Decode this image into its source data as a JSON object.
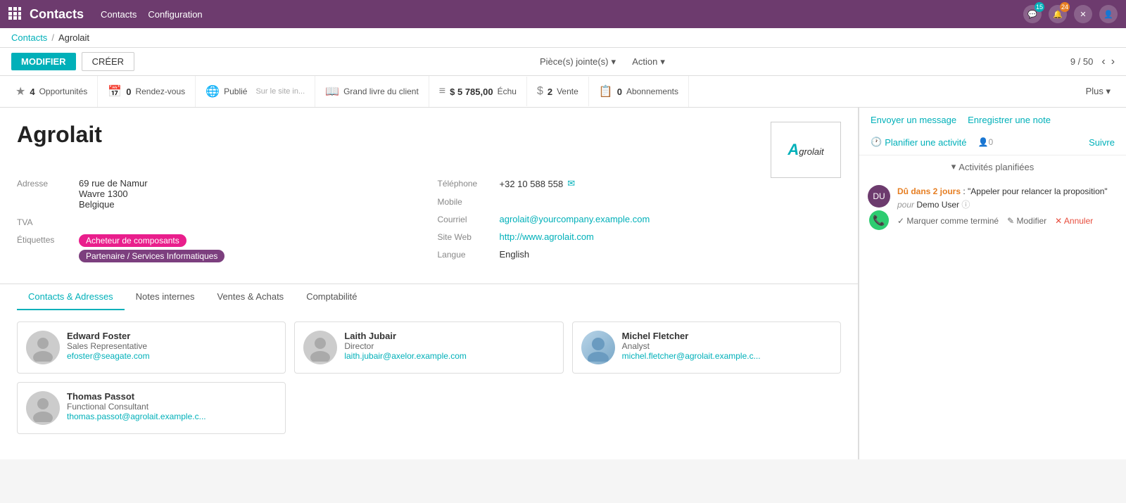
{
  "app": {
    "title": "Contacts",
    "nav_links": [
      "Contacts",
      "Configuration"
    ],
    "badge1": "15",
    "badge2": "24"
  },
  "breadcrumb": {
    "parent": "Contacts",
    "current": "Agrolait"
  },
  "toolbar": {
    "modifier_label": "MODIFIER",
    "creer_label": "CRÉER",
    "piecejointe_label": "Pièce(s) jointe(s)",
    "action_label": "Action",
    "nav_count": "9 / 50"
  },
  "stats": [
    {
      "icon": "★",
      "num": "4",
      "label": "Opportunités"
    },
    {
      "icon": "📅",
      "num": "0",
      "label": "Rendez-vous"
    },
    {
      "icon": "🌐",
      "num": "",
      "label": "Publié",
      "sub": "Sur le site in..."
    },
    {
      "icon": "📖",
      "num": "",
      "label": "Grand livre du client"
    },
    {
      "icon": "≡",
      "num": "$ 5 785,00",
      "label": "Échu"
    },
    {
      "icon": "$",
      "num": "2",
      "label": "Vente"
    },
    {
      "icon": "📋",
      "num": "0",
      "label": "Abonnements"
    },
    {
      "label": "Plus"
    }
  ],
  "contact": {
    "name": "Agrolait",
    "logo_text": "Agrolait",
    "address_label": "Adresse",
    "address_line1": "69 rue de Namur",
    "address_line2": "Wavre  1300",
    "address_line3": "Belgique",
    "tva_label": "TVA",
    "tva_value": "",
    "etiquettes_label": "Étiquettes",
    "tags": [
      {
        "label": "Acheteur de composants",
        "color": "pink"
      },
      {
        "label": "Partenaire / Services Informatiques",
        "color": "purple"
      }
    ],
    "telephone_label": "Téléphone",
    "telephone_value": "+32 10 588 558",
    "mobile_label": "Mobile",
    "mobile_value": "",
    "courriel_label": "Courriel",
    "courriel_value": "agrolait@yourcompany.example.com",
    "siteweb_label": "Site Web",
    "siteweb_value": "http://www.agrolait.com",
    "langue_label": "Langue",
    "langue_value": "English"
  },
  "tabs": [
    {
      "label": "Contacts & Adresses",
      "active": true
    },
    {
      "label": "Notes internes"
    },
    {
      "label": "Ventes & Achats"
    },
    {
      "label": "Comptabilité"
    }
  ],
  "sub_contacts": [
    {
      "name": "Edward Foster",
      "role": "Sales Representative",
      "email": "efoster@seagate.com",
      "has_photo": false
    },
    {
      "name": "Laith Jubair",
      "role": "Director",
      "email": "laith.jubair@axelor.example.com",
      "has_photo": false
    },
    {
      "name": "Michel Fletcher",
      "role": "Analyst",
      "email": "michel.fletcher@agrolait.example.c...",
      "has_photo": true
    },
    {
      "name": "Thomas Passot",
      "role": "Functional Consultant",
      "email": "thomas.passot@agrolait.example.c...",
      "has_photo": false
    }
  ],
  "right_panel": {
    "send_message": "Envoyer un message",
    "save_note": "Enregistrer une note",
    "plan_activity": "Planifier une activité",
    "follower_count": "0",
    "follow_label": "Suivre",
    "activities_title": "Activités planifiées",
    "activity": {
      "due_text": "Dû dans 2 jours",
      "title": "\"Appeler pour relancer la proposition\"",
      "pour": "pour",
      "user": "Demo User",
      "mark_done": "✓ Marquer comme terminé",
      "edit": "✎ Modifier",
      "cancel": "✕ Annuler"
    }
  }
}
